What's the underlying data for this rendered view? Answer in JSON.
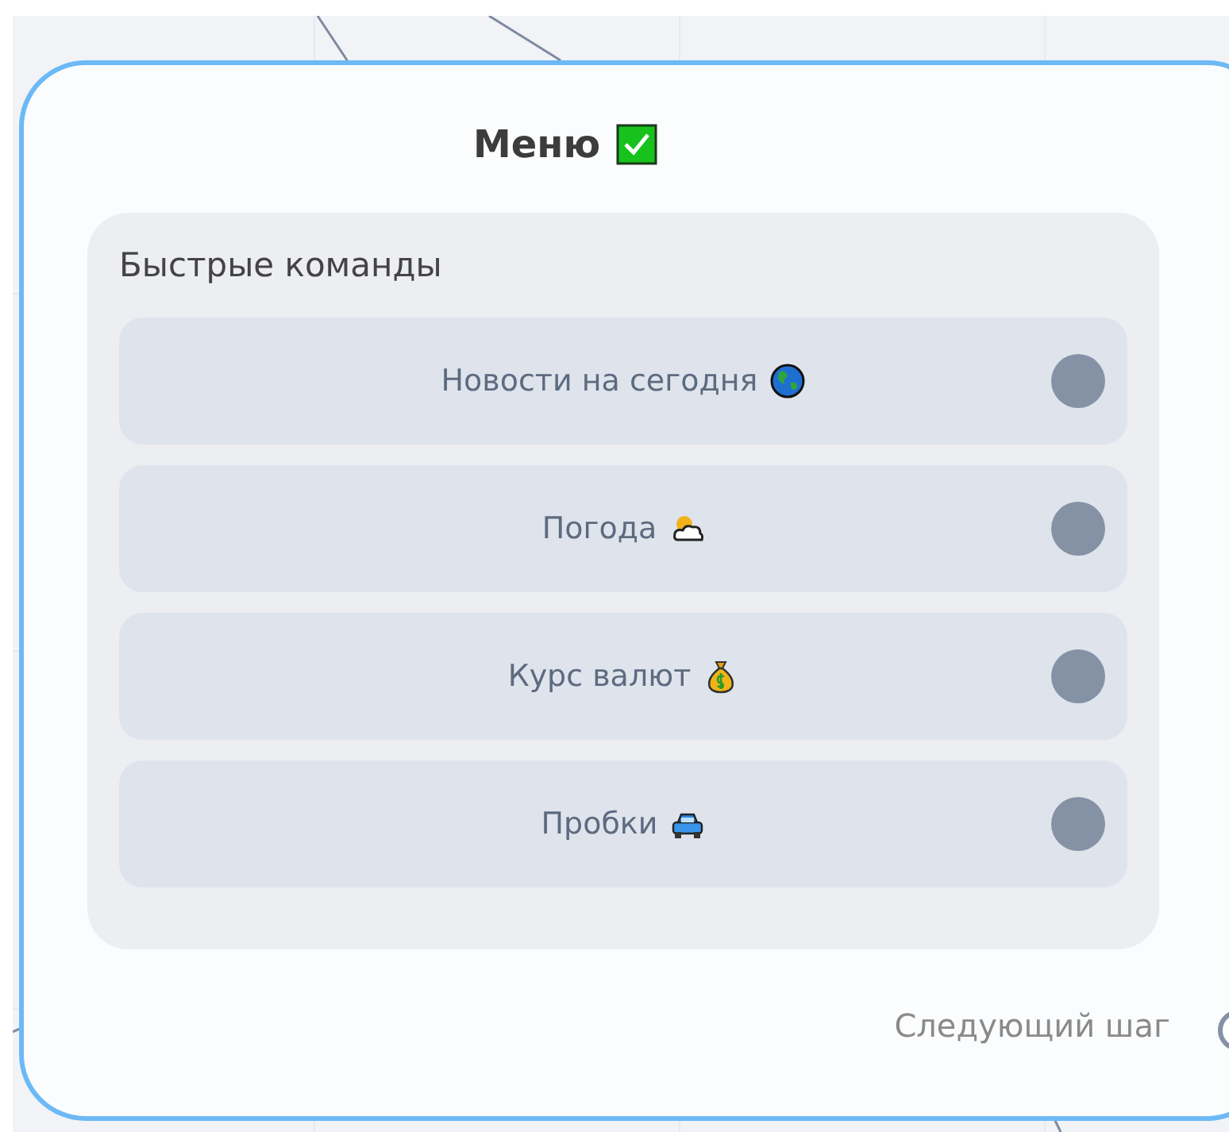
{
  "node": {
    "title": "Меню",
    "group": {
      "title": "Быстрые команды",
      "buttons": [
        {
          "label": "Новости на сегодня",
          "kind": "news"
        },
        {
          "label": "Погода",
          "kind": "weather"
        },
        {
          "label": "Курс валют",
          "kind": "currency"
        },
        {
          "label": "Пробки",
          "kind": "traffic"
        }
      ]
    },
    "next_step": "Следующий шаг"
  }
}
